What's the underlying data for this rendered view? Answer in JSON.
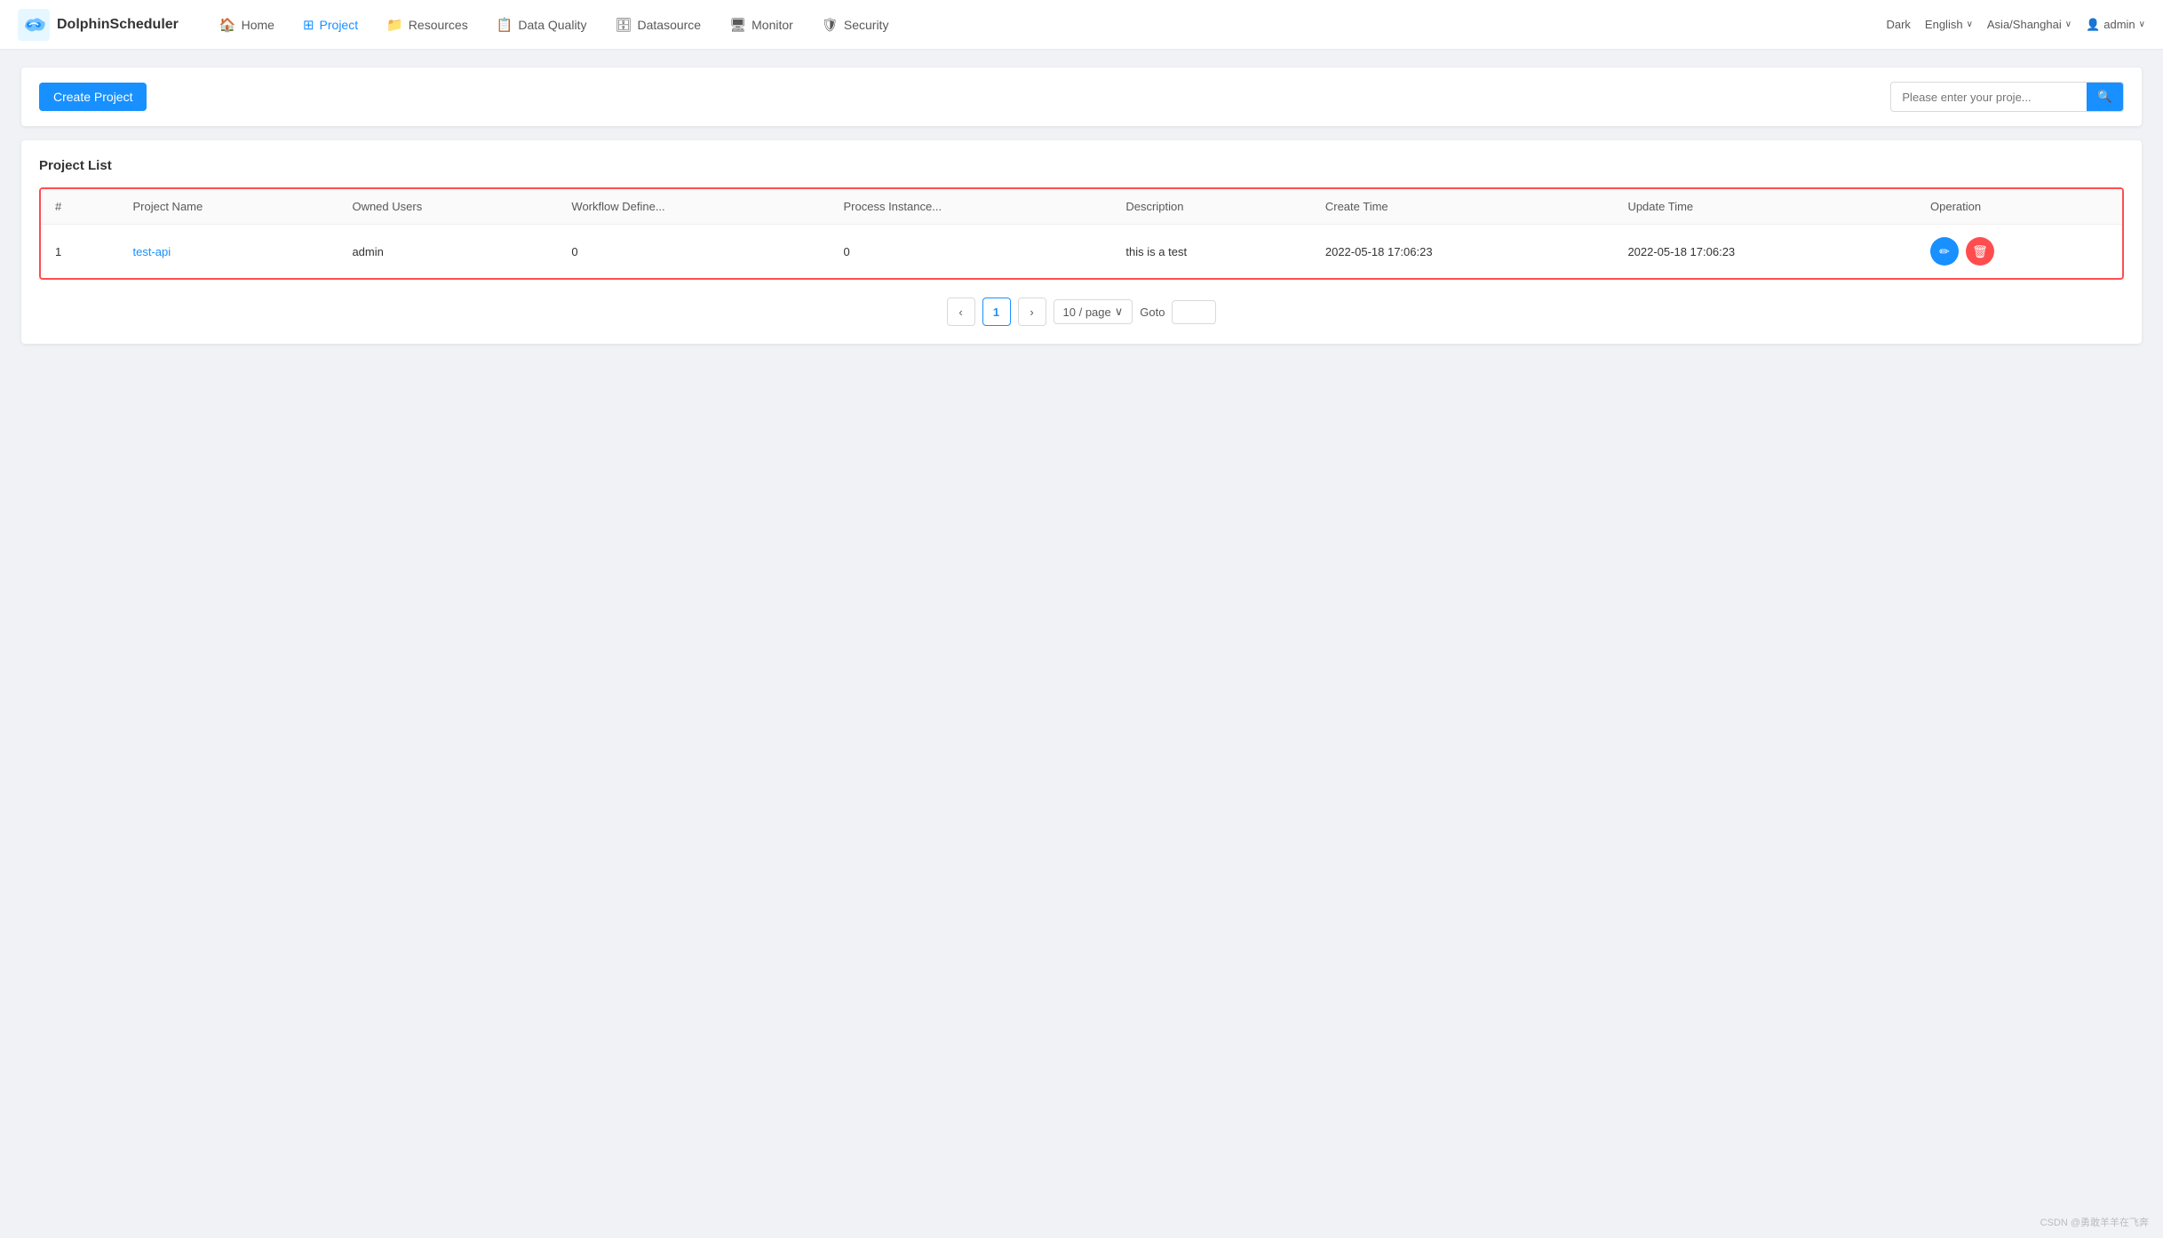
{
  "app": {
    "brand": "DolphinScheduler"
  },
  "navbar": {
    "items": [
      {
        "id": "home",
        "label": "Home",
        "icon": "🏠",
        "active": false
      },
      {
        "id": "project",
        "label": "Project",
        "icon": "⊞",
        "active": true
      },
      {
        "id": "resources",
        "label": "Resources",
        "icon": "📁",
        "active": false
      },
      {
        "id": "data-quality",
        "label": "Data Quality",
        "icon": "📋",
        "active": false
      },
      {
        "id": "datasource",
        "label": "Datasource",
        "icon": "🗄",
        "active": false
      },
      {
        "id": "monitor",
        "label": "Monitor",
        "icon": "🖥",
        "active": false
      },
      {
        "id": "security",
        "label": "Security",
        "icon": "🛡",
        "active": false
      }
    ],
    "right": {
      "theme": "Dark",
      "language": "English",
      "timezone": "Asia/Shanghai",
      "user": "admin"
    }
  },
  "toolbar": {
    "create_label": "Create Project",
    "search_placeholder": "Please enter your proje..."
  },
  "project_list": {
    "title": "Project List",
    "columns": [
      "#",
      "Project Name",
      "Owned Users",
      "Workflow Define...",
      "Process Instance...",
      "Description",
      "Create Time",
      "Update Time",
      "Operation"
    ],
    "rows": [
      {
        "id": 1,
        "project_name": "test-api",
        "owned_users": "admin",
        "workflow_define": "0",
        "process_instance": "0",
        "description": "this is a test",
        "create_time": "2022-05-18 17:06:23",
        "update_time": "2022-05-18 17:06:23"
      }
    ]
  },
  "pagination": {
    "current_page": 1,
    "page_size": "10 / page",
    "goto_label": "Goto"
  },
  "footer": {
    "watermark": "CSDN @勇敢羊羊在飞奔"
  },
  "icons": {
    "search": "🔍",
    "edit": "✏",
    "delete": "🗑",
    "chevron_left": "‹",
    "chevron_right": "›",
    "chevron_down": "∨",
    "user": "👤"
  }
}
